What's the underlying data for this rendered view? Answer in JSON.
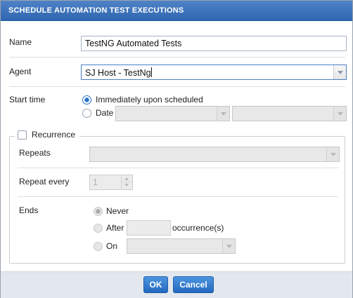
{
  "dialog": {
    "title": "SCHEDULE AUTOMATION TEST EXECUTIONS"
  },
  "form": {
    "name_label": "Name",
    "name_value": "TestNG Automated Tests",
    "agent_label": "Agent",
    "agent_value": "SJ Host - TestNg",
    "start_time_label": "Start time",
    "start_options": {
      "immediately_label": "Immediately upon scheduled",
      "immediately_checked": true,
      "date_label": "Date",
      "date_checked": false
    }
  },
  "recurrence": {
    "legend_label": "Recurrence",
    "checked": false,
    "repeats_label": "Repeats",
    "repeats_value": "",
    "repeat_every_label": "Repeat every",
    "repeat_every_value": "1",
    "ends_label": "Ends",
    "ends_options": {
      "never_label": "Never",
      "never_checked": true,
      "after_label": "After",
      "after_value": "",
      "occurrences_label": "occurrence(s)",
      "on_label": "On"
    }
  },
  "footer": {
    "ok_label": "OK",
    "cancel_label": "Cancel"
  },
  "colors": {
    "title_bar": "#2f67b0",
    "button": "#2468bf",
    "radio_selected": "#2a72c8"
  }
}
